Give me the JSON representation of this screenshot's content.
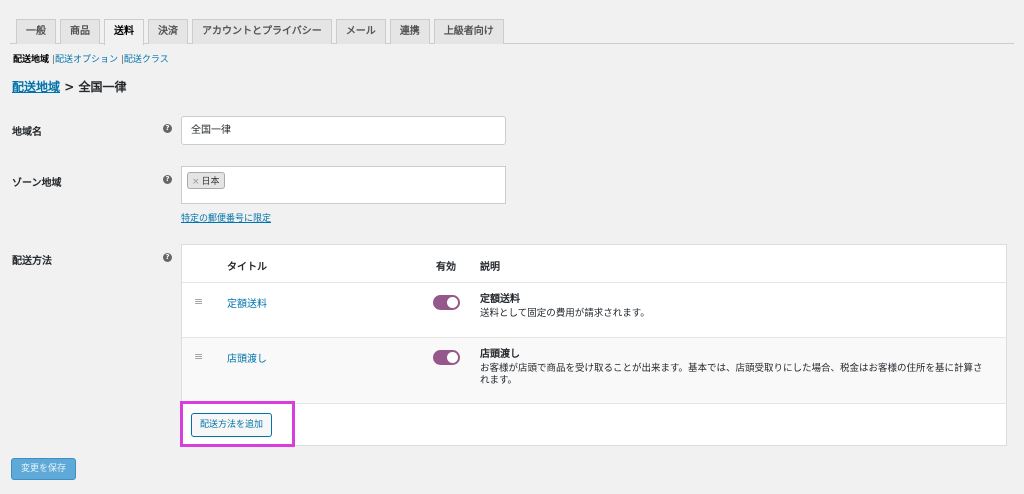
{
  "tabs": [
    "一般",
    "商品",
    "送料",
    "決済",
    "アカウントとプライバシー",
    "メール",
    "連携",
    "上級者向け"
  ],
  "subnav": {
    "current": "配送地域",
    "sep": "|",
    "items": [
      "配送オプション",
      "配送クラス"
    ]
  },
  "breadcrumb": {
    "link": "配送地域",
    "sep": ">",
    "current": "全国一律"
  },
  "fields": {
    "zone_name_label": "地域名",
    "zone_name_value": "全国一律",
    "zone_region_label": "ゾーン地域",
    "region_chip": "日本",
    "region_chip_remove": "×",
    "limit_link": "特定の郵便番号に限定",
    "methods_label": "配送方法",
    "help": "?"
  },
  "methods_table": {
    "headers": {
      "title": "タイトル",
      "enabled": "有効",
      "description": "説明"
    },
    "rows": [
      {
        "title": "定額送料",
        "desc_title": "定額送料",
        "desc": "送料として固定の費用が請求されます。",
        "enabled": true
      },
      {
        "title": "店頭渡し",
        "desc_title": "店頭渡し",
        "desc": "お客様が店頭で商品を受け取ることが出来ます。基本では、店頭受取りにした場合、税金はお客様の住所を基に計算されます。",
        "enabled": true
      }
    ],
    "handle": "≡",
    "add_button": "配送方法を追加"
  },
  "save_button": "変更を保存",
  "colors": {
    "accent": "#96588a",
    "link": "#0073aa",
    "highlight": "#d63ee0"
  }
}
